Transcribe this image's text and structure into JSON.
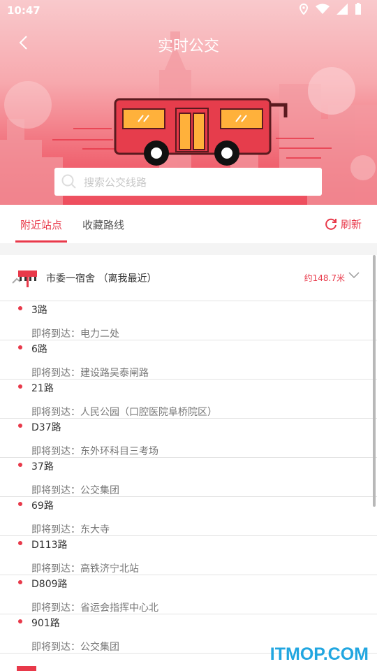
{
  "status_bar": {
    "time": "10:47"
  },
  "header": {
    "title": "实时公交",
    "search_placeholder": "搜索公交线路"
  },
  "tabs": [
    {
      "label": "附近站点",
      "active": true
    },
    {
      "label": "收藏路线",
      "active": false
    }
  ],
  "refresh_label": "刷新",
  "station": {
    "name": "市委一宿舍 （离我最近）",
    "distance": "约148.7米"
  },
  "arriving_prefix": "即将到达：",
  "routes": [
    {
      "line": "3路",
      "arriving": "即将到达：电力二处"
    },
    {
      "line": "6路",
      "arriving": "即将到达：建设路吴泰闸路"
    },
    {
      "line": "21路",
      "arriving": "即将到达：人民公园（口腔医院阜桥院区）"
    },
    {
      "line": "D37路",
      "arriving": "即将到达：东外环科目三考场"
    },
    {
      "line": "37路",
      "arriving": "即将到达：公交集团"
    },
    {
      "line": "69路",
      "arriving": "即将到达：东大寺"
    },
    {
      "line": "D113路",
      "arriving": "即将到达：高铁济宁北站"
    },
    {
      "line": "D809路",
      "arriving": "即将到达：省运会指挥中心北"
    },
    {
      "line": "901路",
      "arriving": "即将到达：公交集团"
    }
  ],
  "watermark": "ITMOP.COM",
  "colors": {
    "accent": "#e8394a",
    "header_top": "#f9c9cc",
    "header_bottom": "#ee4d5d"
  }
}
